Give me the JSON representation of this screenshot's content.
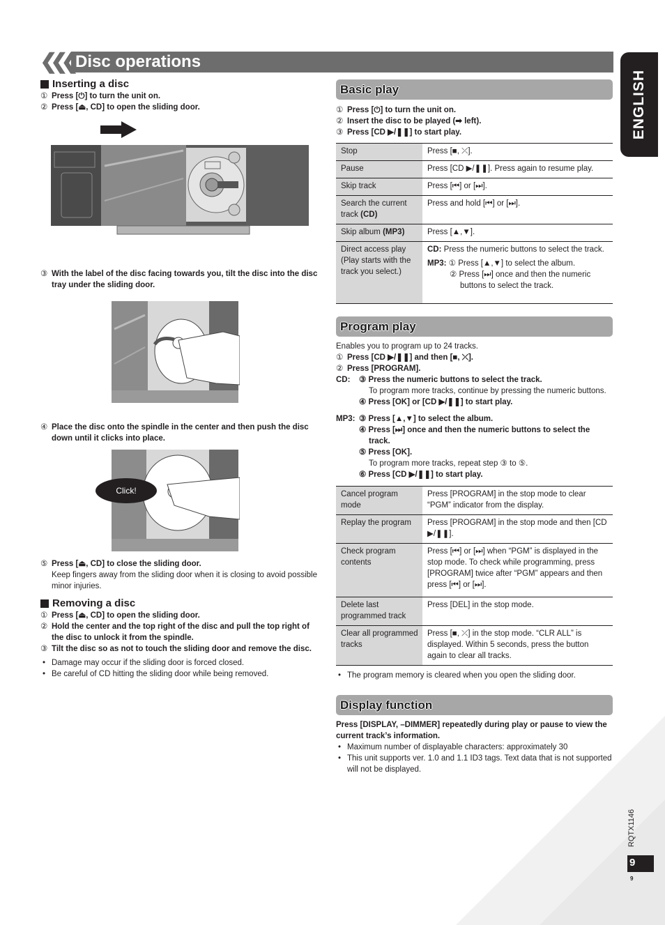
{
  "page": {
    "title": "Disc operations",
    "language_tab": "ENGLISH",
    "doc_id": "RQTX1146",
    "page_number": "9",
    "page_number_small": "9"
  },
  "left": {
    "inserting": {
      "heading": "Inserting a disc",
      "steps": [
        {
          "num": "①",
          "text": "Press [⏻] to turn the unit on."
        },
        {
          "num": "②",
          "text": "Press [⏏, CD] to open the sliding door."
        },
        {
          "num": "③",
          "text": "With the label of the disc facing towards you, tilt the disc into the disc tray under the sliding door."
        },
        {
          "num": "④",
          "text": "Place the disc onto the spindle in the center and then push the disc down until it clicks into place."
        },
        {
          "num": "⑤",
          "text": "Press [⏏, CD] to close the sliding door."
        }
      ],
      "step5_note": "Keep fingers away from the sliding door when it is closing to avoid possible minor injuries.",
      "click_label": "Click!"
    },
    "removing": {
      "heading": "Removing a disc",
      "steps": [
        {
          "num": "①",
          "text": "Press [⏏, CD] to open the sliding door."
        },
        {
          "num": "②",
          "text": "Hold the center and the top right of the disc and pull the top right of the disc to unlock it from the spindle."
        },
        {
          "num": "③",
          "text": "Tilt the disc so as not to touch the sliding door and remove the disc."
        }
      ],
      "bullets": [
        "Damage may occur if the sliding door is forced closed.",
        "Be careful of CD hitting the sliding door while being removed."
      ]
    }
  },
  "basic_play": {
    "heading": "Basic play",
    "steps": [
      {
        "num": "①",
        "text": "Press [⏻] to turn the unit on."
      },
      {
        "num": "②",
        "text": "Insert the disc to be played (➡ left)."
      },
      {
        "num": "③",
        "text": "Press [CD ▶/❚❚] to start play."
      }
    ],
    "table": [
      {
        "key": "Stop",
        "key_bold": "",
        "value": "Press [■, ⤫]."
      },
      {
        "key": "Pause",
        "key_bold": "",
        "value": "Press [CD ▶/❚❚]. Press again to resume play."
      },
      {
        "key": "Skip track",
        "key_bold": "",
        "value": "Press [⏮] or [⏭]."
      },
      {
        "key": "Search the current track ",
        "key_bold": "(CD)",
        "value": "Press and hold [⏮] or [⏭]."
      },
      {
        "key": "Skip album ",
        "key_bold": "(MP3)",
        "value": "Press [▲,▼]."
      }
    ],
    "direct_access": {
      "key": "Direct access play (Play starts with the track you select.)",
      "cd_label": "CD:",
      "cd_text": "Press the numeric buttons to select the track.",
      "mp3_label": "MP3:",
      "mp3_step1": "① Press [▲,▼] to select the album.",
      "mp3_step2": "② Press [⏭] once and then the numeric buttons to select the track."
    }
  },
  "program_play": {
    "heading": "Program play",
    "intro": "Enables you to program up to 24 tracks.",
    "steps_common": [
      {
        "num": "①",
        "text": "Press [CD ▶/❚❚] and then [■, ⤫]."
      },
      {
        "num": "②",
        "text": "Press [PROGRAM]."
      }
    ],
    "cd_label": "CD:",
    "cd_step3": "③ Press the numeric buttons to select the track.",
    "cd_step3_note": "To program more tracks, continue by pressing the numeric buttons.",
    "cd_step4": "④ Press [OK] or [CD ▶/❚❚] to start play.",
    "mp3_label": "MP3:",
    "mp3_step3": "③ Press [▲,▼] to select the album.",
    "mp3_step4": "④ Press [⏭] once and then the numeric buttons to select the track.",
    "mp3_step5": "⑤ Press [OK].",
    "mp3_step5_note": "To program more tracks, repeat step ③ to ⑤.",
    "mp3_step6": "⑥ Press [CD ▶/❚❚] to start play.",
    "table": [
      {
        "key": "Cancel program mode",
        "value": "Press [PROGRAM] in the stop mode to clear “PGM” indicator from the display."
      },
      {
        "key": "Replay the program",
        "value": "Press [PROGRAM] in the stop mode and then [CD ▶/❚❚]."
      },
      {
        "key": "Check program contents",
        "value": "Press [⏮] or [⏭] when “PGM” is displayed in the stop mode. To check while programming, press [PROGRAM] twice after “PGM” appears and then press [⏮] or [⏭]."
      },
      {
        "key": "Delete last programmed track",
        "value": "Press [DEL] in the stop mode."
      },
      {
        "key": "Clear all programmed tracks",
        "value": "Press [■, ⤫] in the stop mode. “CLR ALL” is displayed. Within 5 seconds, press the button again to clear all tracks."
      }
    ],
    "bullet": "The program memory is cleared when you open the sliding door."
  },
  "display_function": {
    "heading": "Display function",
    "lead": "Press [DISPLAY, –DIMMER] repeatedly during play or pause to view the current track’s information.",
    "bullets": [
      "Maximum number of displayable characters: approximately 30",
      "This unit supports ver. 1.0 and 1.1 ID3 tags. Text data that is not supported will not be displayed."
    ]
  }
}
